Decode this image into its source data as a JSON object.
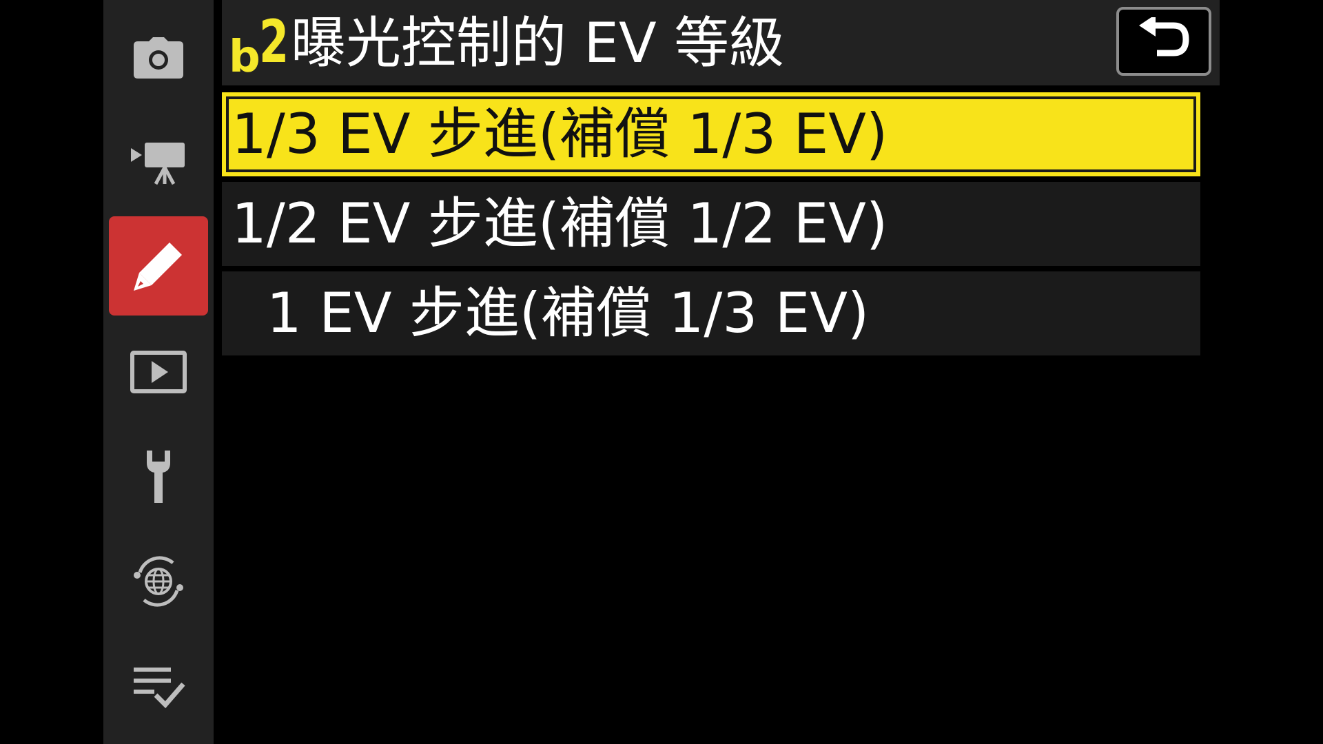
{
  "header": {
    "code_letter": "b",
    "code_number": "2",
    "title": "曝光控制的 EV 等級",
    "back_icon": "return-arrow-icon"
  },
  "sidebar": {
    "items": [
      {
        "icon": "camera-icon",
        "active": false
      },
      {
        "icon": "movie-camera-icon",
        "active": false
      },
      {
        "icon": "pencil-icon",
        "active": true
      },
      {
        "icon": "playback-icon",
        "active": false
      },
      {
        "icon": "wrench-icon",
        "active": false
      },
      {
        "icon": "network-globe-icon",
        "active": false
      },
      {
        "icon": "my-menu-checklist-icon",
        "active": false
      }
    ]
  },
  "options": [
    {
      "label": "1/3 EV 步進(補償 1/3 EV)",
      "selected": true
    },
    {
      "label": "1/2 EV 步進(補償 1/2 EV)",
      "selected": false
    },
    {
      "label": "  1 EV 步進(補償 1/3 EV)",
      "selected": false
    }
  ],
  "colors": {
    "accent_yellow": "#f8e31a",
    "active_tab_red": "#cc3333",
    "panel_gray": "#222222",
    "icon_gray": "#bdbdbd"
  }
}
